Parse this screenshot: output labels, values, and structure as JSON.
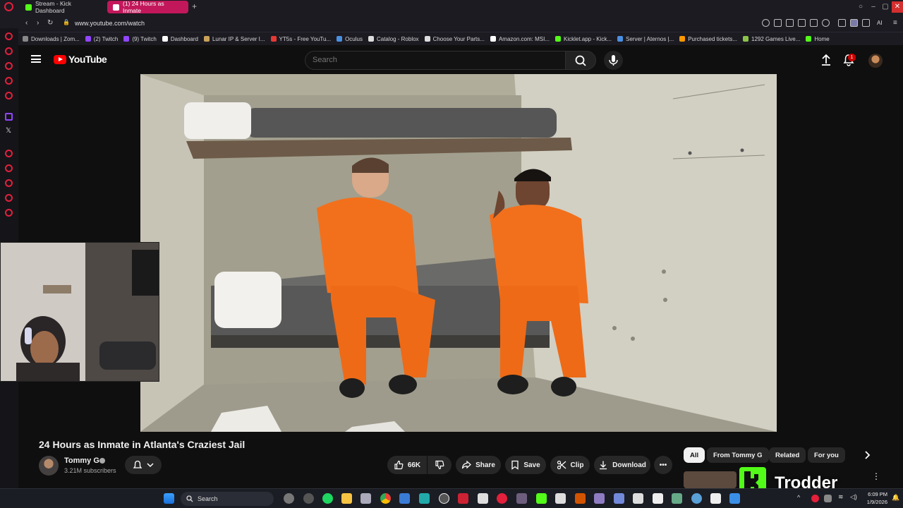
{
  "browser": {
    "tabs": [
      {
        "label": "Stream - Kick Dashboard",
        "active": false
      },
      {
        "label": "(1) 24 Hours as Inmate",
        "active": true
      }
    ],
    "url": "www.youtube.com/watch",
    "ai_label": "AI"
  },
  "bookmarks": [
    {
      "label": "Downloads | Zom...",
      "color": "#888888"
    },
    {
      "label": "(2) Twitch",
      "color": "#9146ff"
    },
    {
      "label": "(9) Twitch",
      "color": "#9146ff"
    },
    {
      "label": "Dashboard",
      "color": "#ffffff"
    },
    {
      "label": "Lunar IP & Server I...",
      "color": "#c9a15a"
    },
    {
      "label": "YT5s - Free YouTu...",
      "color": "#e53935"
    },
    {
      "label": "Oculus",
      "color": "#4a90e2"
    },
    {
      "label": "Catalog - Roblox",
      "color": "#dddddd"
    },
    {
      "label": "Choose Your Parts...",
      "color": "#dddddd"
    },
    {
      "label": "Amazon.com: MSI...",
      "color": "#ffffff"
    },
    {
      "label": "Kicklet.app - Kick...",
      "color": "#53fc18"
    },
    {
      "label": "Server | Aternos |...",
      "color": "#4a90e2"
    },
    {
      "label": "Purchased tickets...",
      "color": "#ff9800"
    },
    {
      "label": "1292 Games Live...",
      "color": "#8bc34a"
    },
    {
      "label": "Home",
      "color": "#53fc18"
    }
  ],
  "youtube": {
    "logo_text": "YouTube",
    "search_placeholder": "Search",
    "notification_count": "1",
    "video": {
      "title": "24 Hours as Inmate in Atlanta's Craziest Jail",
      "channel": "Tommy G",
      "subscribers": "3.21M subscribers",
      "likes": "66K",
      "actions": {
        "share": "Share",
        "save": "Save",
        "clip": "Clip",
        "download": "Download"
      }
    },
    "chips": [
      "All",
      "From Tommy G",
      "Related",
      "For you"
    ]
  },
  "taskbar": {
    "search_label": "Search",
    "time": "6:09 PM",
    "date": "1/9/2026"
  },
  "overlay": {
    "brand": "Trodder"
  },
  "colors": {
    "youtube_red": "#ff0000",
    "kick_green": "#53fc18",
    "opera_red": "#e3203b",
    "jumpsuit_orange": "#f2701c"
  }
}
